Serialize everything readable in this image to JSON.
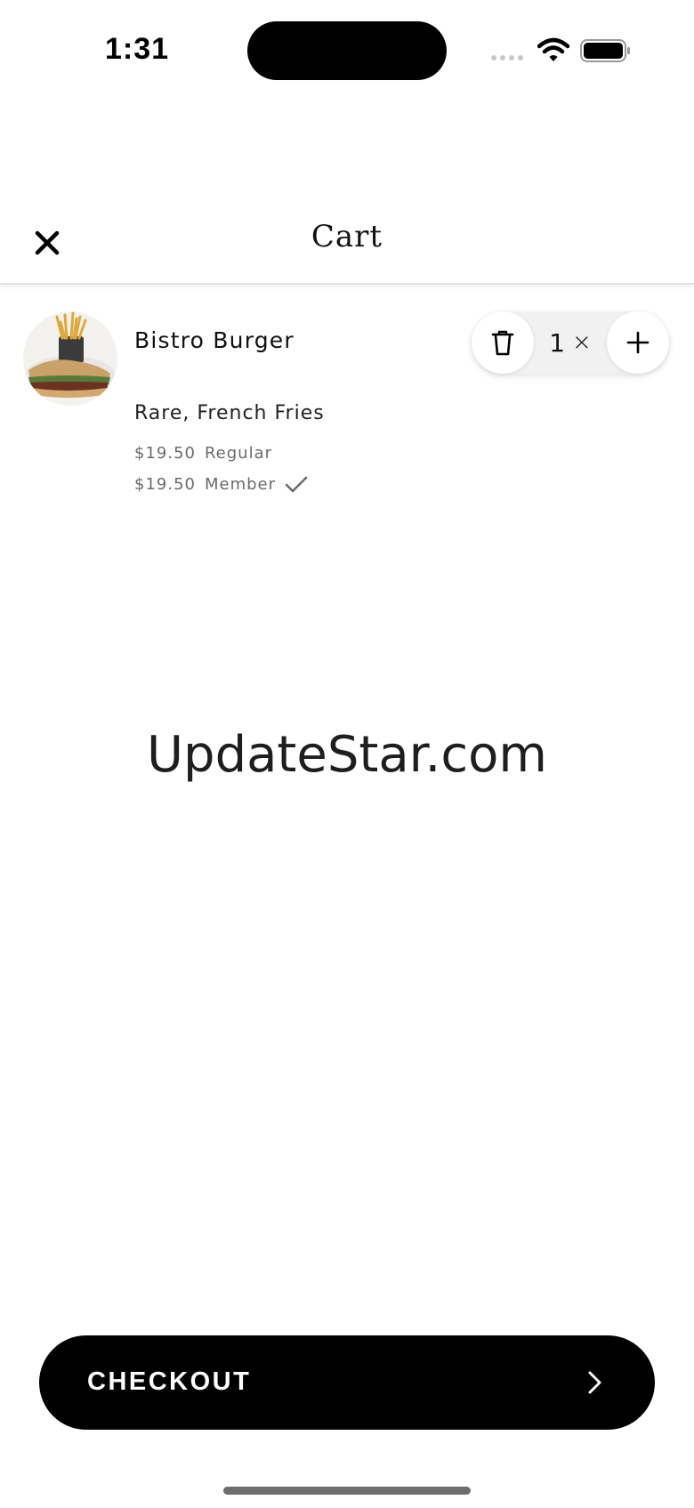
{
  "status_bar": {
    "time": "1:31",
    "icons": [
      "signal-icon",
      "wifi-icon",
      "battery-icon"
    ]
  },
  "header": {
    "title": "Cart",
    "close_icon": "close-icon"
  },
  "cart": {
    "items": [
      {
        "name": "Bistro Burger",
        "options": "Rare, French Fries",
        "regular_price": "$19.50",
        "regular_label": "Regular",
        "member_price": "$19.50",
        "member_label": "Member",
        "member_selected": true,
        "quantity": "1",
        "quantity_suffix": "×"
      }
    ]
  },
  "watermark": "UpdateStar.com",
  "checkout": {
    "label": "CHECKOUT",
    "icon": "chevron-right-icon"
  },
  "colors": {
    "primary": "#000000",
    "background": "#ffffff",
    "muted_text": "#6b6b6b",
    "stepper_bg": "#f1f1f1"
  }
}
